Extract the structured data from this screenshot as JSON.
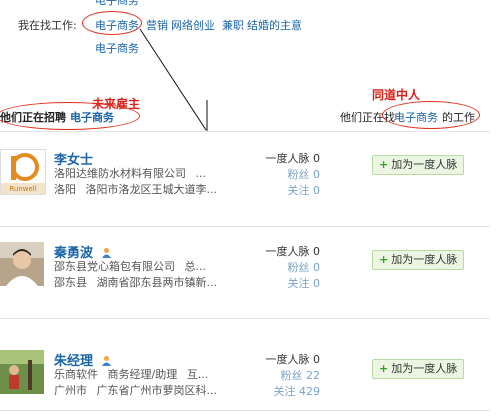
{
  "top": {
    "cut_link": "电子商务",
    "prefix": "我在找工作:",
    "links": [
      "电子商务",
      "营销",
      "网络创业",
      "兼职",
      "结婚的主意"
    ],
    "second_line": "电子商务"
  },
  "annotations": {
    "left": "未来雇主",
    "right": "同道中人"
  },
  "section": {
    "left_label": "他们正在招聘",
    "left_link": "电子商务",
    "right_prefix": "他们正在找",
    "right_link": "电子商务",
    "right_suffix": "的工作"
  },
  "people": [
    {
      "name": "李女士",
      "company": "洛阳达维防水材料有限公司",
      "company_more": "...",
      "city": "洛阳",
      "address": "洛阳市洛龙区王城大道李...",
      "metric_label": "一度人脉",
      "metric_value": "0",
      "fans_label": "粉丝",
      "fans_value": "0",
      "follow_label": "关注",
      "follow_value": "0",
      "button": "加为一度人脉",
      "avatar_text": "Runwell"
    },
    {
      "name": "秦勇波",
      "company": "邵东县党心箱包有限公司",
      "company_more": "总...",
      "city": "邵东县",
      "address": "湖南省邵东县两市镇新...",
      "metric_label": "一度人脉",
      "metric_value": "0",
      "fans_label": "粉丝",
      "fans_value": "0",
      "follow_label": "关注",
      "follow_value": "0",
      "button": "加为一度人脉"
    },
    {
      "name": "朱经理",
      "company": "乐商软件",
      "title": "商务经理/助理",
      "company_more": "互...",
      "city": "广州市",
      "address": "广东省广州市萝岗区科...",
      "metric_label": "一度人脉",
      "metric_value": "0",
      "fans_label": "粉丝",
      "fans_value": "22",
      "follow_label": "关注",
      "follow_value": "429",
      "button": "加为一度人脉"
    }
  ],
  "colors": {
    "link": "#1a64a8",
    "annotation": "#d8211a",
    "button_bg": "#eaf6e2",
    "button_border": "#b9dba3"
  }
}
